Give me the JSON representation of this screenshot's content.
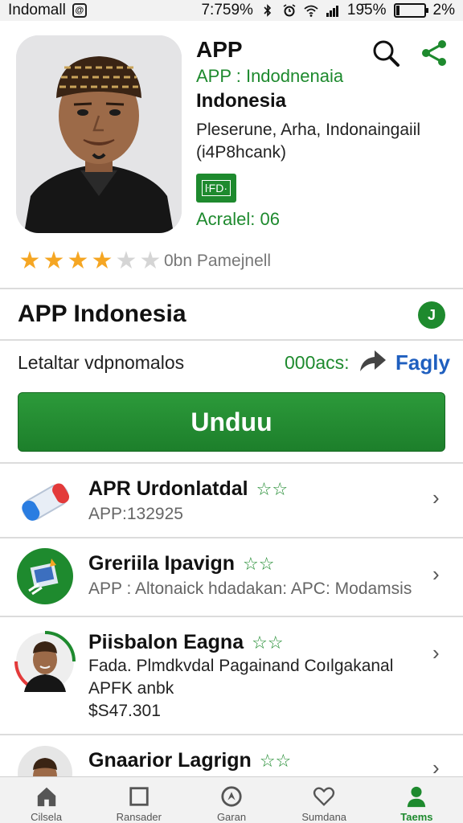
{
  "status_bar": {
    "app_name": "Indomall",
    "app_icon_glyph": "@",
    "time": "7:759%",
    "signal_text": "19̄5%",
    "battery_text": "2%",
    "battery_level": 0.12
  },
  "header": {
    "title": "APP",
    "subtitle": "APP : Indodnenaia",
    "country": "Indonesia",
    "description": "Pleserune, Arha, Indonaingaiil (i4P8hcank)",
    "badge": "ŀFD·",
    "meta": "Acralel: 06",
    "rating": {
      "value": 4,
      "max": 6,
      "text": "0bn Pamejnell"
    },
    "icons": {
      "search": "search-icon",
      "share": "share-icon"
    }
  },
  "section": {
    "title": "APP Indonesia",
    "badge_glyph": "J"
  },
  "info": {
    "label": "Letaltar vdpnomalos",
    "count": "000acs:",
    "link": "Fagly"
  },
  "download": {
    "label": "Unduu"
  },
  "list": [
    {
      "title": "APR Urdonlatdal",
      "stars": "☆☆",
      "lines": [
        "APP:132925"
      ]
    },
    {
      "title": "Greriila Ipavign",
      "stars": "☆☆",
      "lines": [
        "APP : Altonaick hdadakan: APC: Modamsis"
      ]
    },
    {
      "title": "Piisbalon Eagna",
      "stars": "☆☆",
      "lines": [
        "Fada. Plmdkvdal Pagainand Coılgakanal",
        "APFK anbk",
        "$S47.301"
      ]
    },
    {
      "title": "Gnaarior Lagrign",
      "stars": "☆☆",
      "lines": []
    }
  ],
  "nav": [
    {
      "label": "Cilsela",
      "icon": "home-icon"
    },
    {
      "label": "Ransader",
      "icon": "square-icon"
    },
    {
      "label": "Garan",
      "icon": "compass-icon"
    },
    {
      "label": "Sumdana",
      "icon": "heart-icon"
    },
    {
      "label": "Taems",
      "icon": "person-icon"
    }
  ],
  "colors": {
    "accent": "#1e8a2e",
    "link": "#1f5fbf",
    "star": "#f5a623"
  }
}
